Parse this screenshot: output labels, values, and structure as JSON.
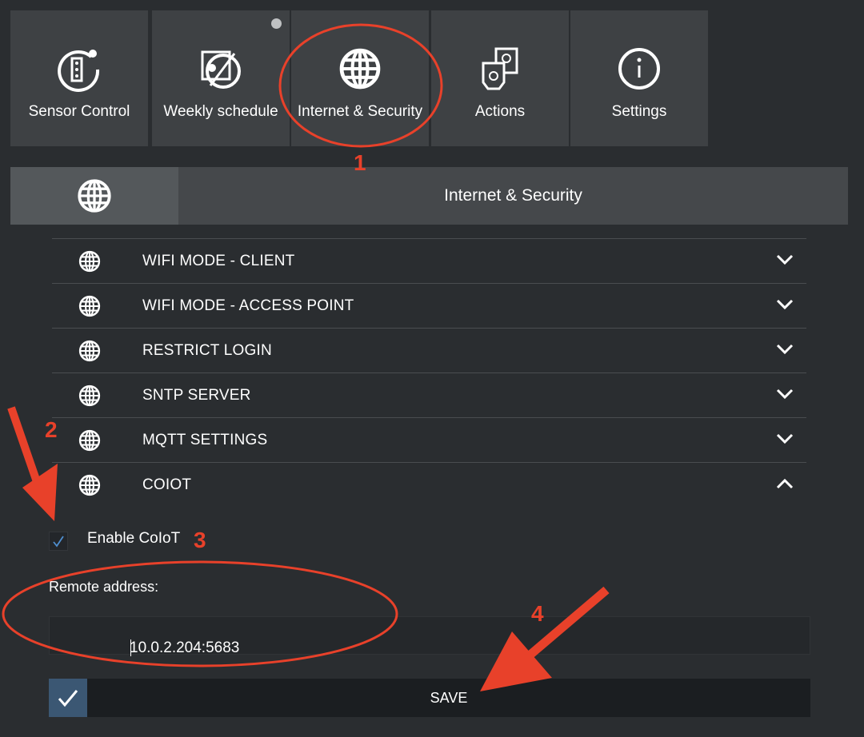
{
  "nav_tiles": [
    {
      "label": "Sensor Control",
      "icon": "sensor-gear-icon"
    },
    {
      "label": "Weekly schedule",
      "icon": "schedule-icon"
    },
    {
      "label": "Internet & Security",
      "icon": "globe-icon"
    },
    {
      "label": "Actions",
      "icon": "actions-icon"
    },
    {
      "label": "Settings",
      "icon": "info-icon"
    }
  ],
  "section": {
    "title": "Internet & Security",
    "icon": "globe-icon"
  },
  "rows": [
    {
      "label": "WIFI MODE - CLIENT",
      "expanded": false
    },
    {
      "label": "WIFI MODE - ACCESS POINT",
      "expanded": false
    },
    {
      "label": "RESTRICT LOGIN",
      "expanded": false
    },
    {
      "label": "SNTP SERVER",
      "expanded": false
    },
    {
      "label": "MQTT SETTINGS",
      "expanded": false
    },
    {
      "label": "COIOT",
      "expanded": true
    }
  ],
  "coiot": {
    "enable_label": "Enable CoIoT",
    "enable_checked": true,
    "remote_label": "Remote address:",
    "remote_value": "10.0.2.204:5683",
    "save_label": "SAVE"
  },
  "annotations": [
    "1",
    "2",
    "3",
    "4"
  ],
  "colors": {
    "annotation": "#e8412a",
    "save_check_bg": "#3b5773",
    "background": "#2a2d30"
  }
}
